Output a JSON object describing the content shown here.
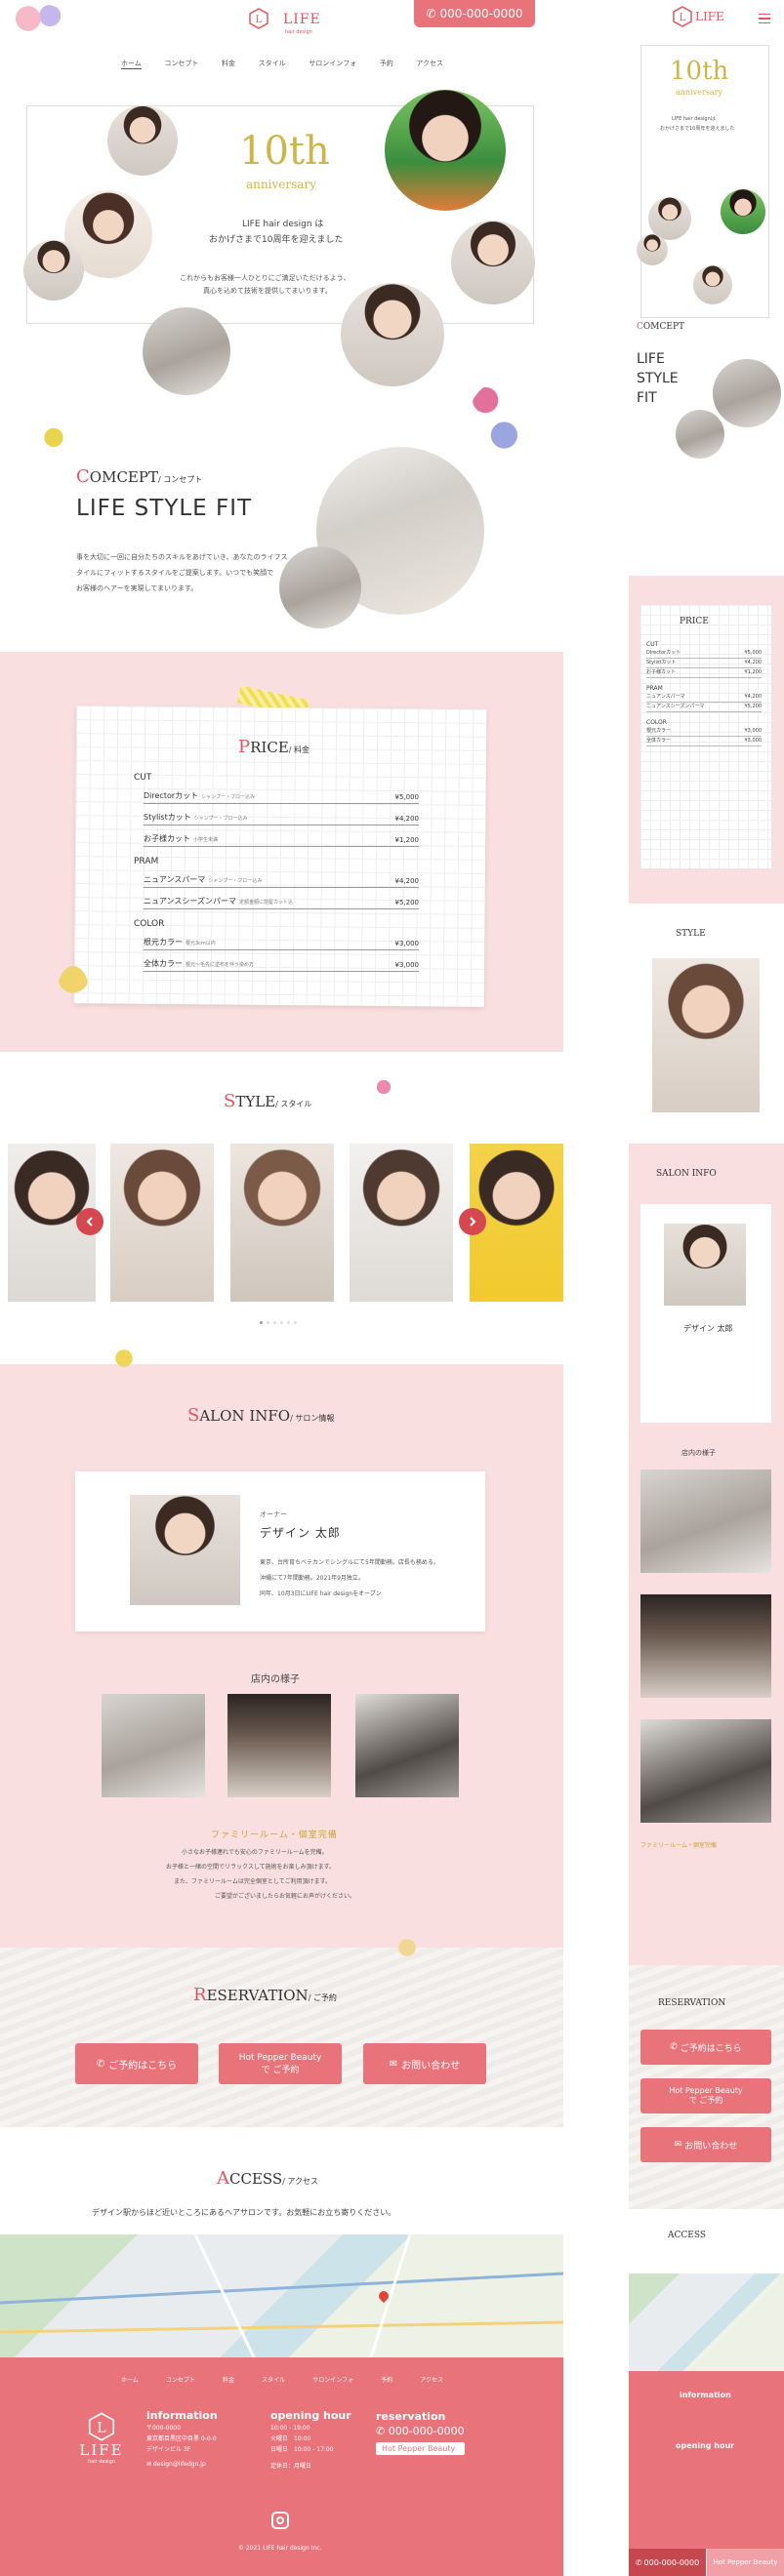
{
  "header": {
    "logo": "LIFE",
    "logo_sub": "hair design",
    "phone": "000-000-0000"
  },
  "nav": [
    "ホーム",
    "コンセプト",
    "料金",
    "スタイル",
    "サロンインフォ",
    "予約",
    "アクセス"
  ],
  "hero": {
    "ten": "10th",
    "anniversary": "anniversary",
    "line1": "LIFE hair design は",
    "line2": "おかげさまで10周年を迎えました",
    "desc1": "これからもお客様一人ひとりにご満足いただけるよう、",
    "desc2": "真心を込めて技術を提供してまいります。"
  },
  "concept": {
    "cap": "C",
    "title": "OMCEPT",
    "ja": "/ コンセプト",
    "headline": "LIFE STYLE FIT",
    "body1": "事を大切に一回に自分たちのスキルをあげていき、あなたのライフス",
    "body2": "タイルにフィットするスタイルをご提案します。いつでも笑顔で",
    "body3": "お客様のヘアーを実現してまいります。"
  },
  "price": {
    "cap": "P",
    "title": "RICE",
    "ja": "/ 料金",
    "groups": [
      {
        "name": "CUT",
        "items": [
          {
            "name": "Directorカット",
            "note": "シャンプー・ブロー込み",
            "price": "¥5,000"
          },
          {
            "name": "Stylistカット",
            "note": "シャンプー・ブロー込み",
            "price": "¥4,200"
          },
          {
            "name": "お子様カット",
            "note": "小学生未満",
            "price": "¥1,200"
          }
        ]
      },
      {
        "name": "PRAM",
        "items": [
          {
            "name": "ニュアンスパーマ",
            "note": "シャンプー・ブロー込み",
            "price": "¥4,200"
          },
          {
            "name": "ニュアンスシーズンパーマ",
            "note": "定額金額に前髪カット込",
            "price": "¥5,200"
          }
        ]
      },
      {
        "name": "COLOR",
        "items": [
          {
            "name": "根元カラー",
            "note": "根元3cm以内",
            "price": "¥3,000"
          },
          {
            "name": "全体カラー",
            "note": "根元～毛先に塗布を伴う染め方",
            "price": "¥3,000"
          }
        ]
      }
    ]
  },
  "style": {
    "cap": "S",
    "title": "TYLE",
    "ja": "/ スタイル"
  },
  "salon": {
    "cap": "S",
    "title": "ALON INFO",
    "ja": "/ サロン情報",
    "role": "オーナー",
    "owner": "デザイン 太郎",
    "bio1": "東京、台所育ちベテカンでシングルにて5年間勤務。店長も務める。",
    "bio2": "沖縄にて7年間勤務。2021年9月独立。",
    "bio3": "同年、10月3日にLIFE hair designをオープン",
    "inside": "店内の様子",
    "family": "ファミリールーム・個室完備",
    "fam1": "小さなお子様連れでも安心のファミリールームを完備。",
    "fam2": "お子様と一緒の空間でリラックスして施術をお楽しみ頂けます。",
    "fam3": "また、ファミリールームは完全個室としてご利用頂けます。",
    "fam4": "ご要望がございましたらお気軽にお声がけください。"
  },
  "reservation": {
    "cap": "R",
    "title": "ESERVATION",
    "ja": "/ ご予約",
    "btn1": "ご予約はこちら",
    "btn2a": "Hot Pepper Beauty",
    "btn2b": "で ご予約",
    "btn3": "お問い合わせ"
  },
  "access": {
    "cap": "A",
    "title": "CCESS",
    "ja": "/ アクセス",
    "desc": "デザイン駅からほど近いところにあるヘアサロンです。お気軽にお立ち寄りください。"
  },
  "footer": {
    "logo": "LIFE",
    "logo_sub": "hair design",
    "info_title": "information",
    "zip": "〒000-0000",
    "addr1": "東京都目黒区中目黒 0-0-0",
    "addr2": "デザインビル 3F",
    "mail": "design@lifedgn.jp",
    "hours_title": "opening hour",
    "h1": "10:00 - 19:00",
    "h2": "火曜日　10:00",
    "h3": "日曜日　10:00 - 17:00",
    "closed": "定休日：月曜日",
    "res_title": "reservation",
    "phone": "000-000-0000",
    "hpb": "Hot Pepper Beauty",
    "copy": "© 2021 LIFE hair design Inc."
  },
  "mobile": {
    "ten": "10th",
    "anniv": "anniversary",
    "hero1": "LIFE hair designは",
    "hero2": "おかげさまで10周年を迎えました",
    "concept": "LIFE STYLE FIT",
    "price_t": "PRICE",
    "style_t": "STYLE",
    "salon_t": "SALON INFO",
    "owner": "デザイン 太郎",
    "inside": "店内の様子",
    "family": "ファミリールーム・個室完備",
    "res_t": "RESERVATION",
    "res1": "ご予約はこちら",
    "res2a": "Hot Pepper Beauty",
    "res2b": "で ご予約",
    "res3": "お問い合わせ",
    "access_t": "ACCESS",
    "info": "information",
    "hours": "opening hour",
    "bottom_phone": "000-000-0000",
    "bottom_hpb": "Hot Pepper Beauty"
  }
}
